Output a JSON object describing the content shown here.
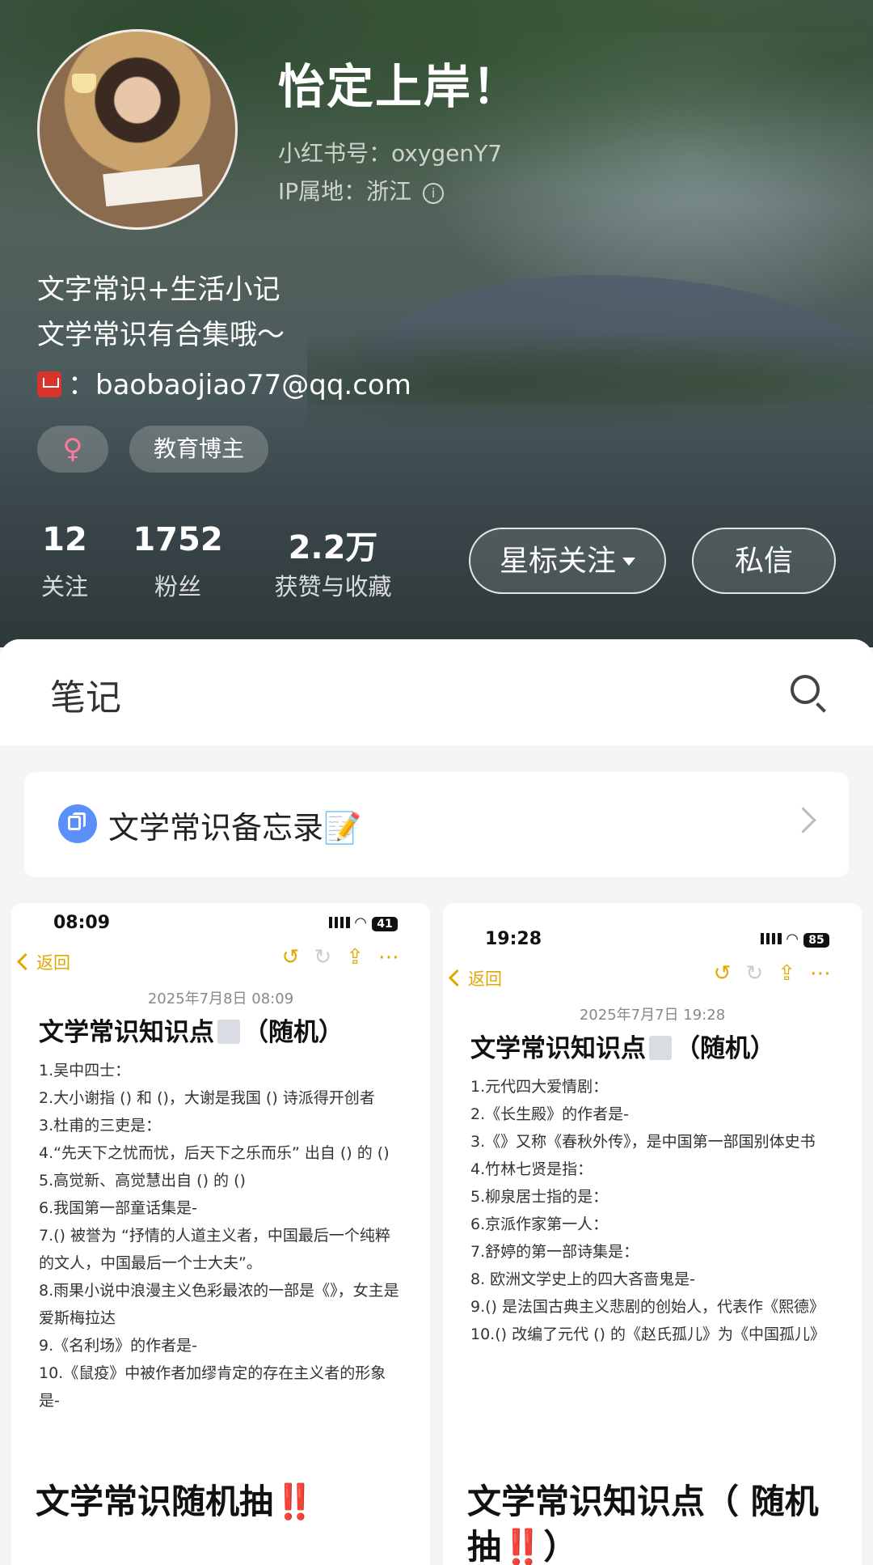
{
  "profile": {
    "name": "怡定上岸！",
    "id_line": "小红书号：oxygenY7",
    "ip_line": "IP属地：浙江",
    "bio": [
      "文字常识+生活小记",
      "文学常识有合集哦～",
      "baobaojiao77@qq.com"
    ],
    "mail_prefix": "：",
    "tags": {
      "gender": "♀",
      "category": "教育博主"
    },
    "stats": [
      {
        "num": "12",
        "label": "关注"
      },
      {
        "num": "1752",
        "label": "粉丝"
      },
      {
        "num": "2.2万",
        "label": "获赞与收藏"
      }
    ],
    "buttons": {
      "star_follow": "星标关注",
      "message": "私信"
    }
  },
  "tabs": {
    "notes": "笔记"
  },
  "collection": {
    "title": "文学常识备忘录📝"
  },
  "cards": [
    {
      "status_time": "08:09",
      "battery": "41",
      "back_label": "返回",
      "date": "2025年7月8日 08:09",
      "note_title_a": "文学常识知识点",
      "note_title_b": "（随机）",
      "lines": [
        "1.吴中四士：",
        "2.大小谢指 () 和 ()，大谢是我国 () 诗派得开创者",
        "3.杜甫的三吏是：",
        "4.“先天下之忧而忧，后天下之乐而乐” 出自 () 的 ()",
        "5.高觉新、高觉慧出自 () 的 ()",
        "6.我国第一部童话集是-",
        "7.() 被誉为 “抒情的人道主义者，中国最后一个纯粹的文人，中国最后一个士大夫”。",
        "8.雨果小说中浪漫主义色彩最浓的一部是《》，女主是爱斯梅拉达",
        "9.《名利场》的作者是-",
        "10.《鼠疫》中被作者加缪肯定的存在主义者的形象是-"
      ],
      "title_a": "文学常识随机抽",
      "title_bang": "‼️",
      "title_c": ""
    },
    {
      "status_time": "19:28",
      "battery": "85",
      "back_label": "返回",
      "date": "2025年7月7日 19:28",
      "note_title_a": "文学常识知识点",
      "note_title_b": "（随机）",
      "lines": [
        "1.元代四大爱情剧：",
        "2.《长生殿》的作者是-",
        "3.《》又称《春秋外传》，是中国第一部国别体史书",
        "4.竹林七贤是指：",
        "5.柳泉居士指的是：",
        "6.京派作家第一人：",
        "7.舒婷的第一部诗集是：",
        "8. 欧洲文学史上的四大吝啬鬼是-",
        "9.() 是法国古典主义悲剧的创始人，代表作《熙德》",
        "10.() 改编了元代 () 的《赵氏孤儿》为《中国孤儿》"
      ],
      "title_a": "文学常识知识点（ 随机抽",
      "title_bang": "‼️",
      "title_c": "）"
    }
  ]
}
